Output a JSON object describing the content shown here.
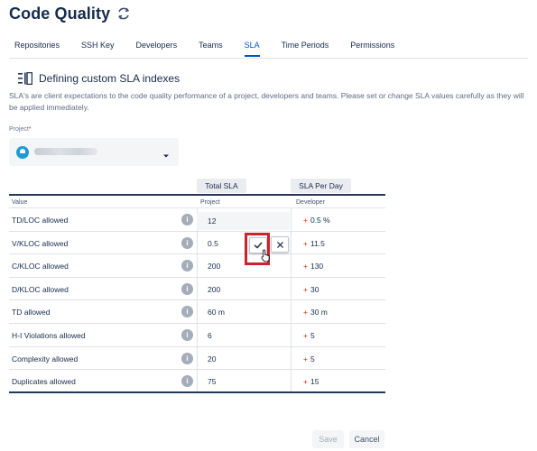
{
  "app": {
    "title": "Code Quality",
    "refresh_icon": "refresh-icon"
  },
  "tabs": [
    {
      "label": "Repositories",
      "active": false
    },
    {
      "label": "SSH Key",
      "active": false
    },
    {
      "label": "Developers",
      "active": false
    },
    {
      "label": "Teams",
      "active": false
    },
    {
      "label": "SLA",
      "active": true
    },
    {
      "label": "Time Periods",
      "active": false
    },
    {
      "label": "Permissions",
      "active": false
    }
  ],
  "section": {
    "title": "Defining custom SLA indexes",
    "icon": "list-settings-icon",
    "description": "SLA's are client expectations to the code quality performance of a project, developers and teams. Please set or change SLA values carefully as they will be applied immediately."
  },
  "project_field": {
    "label": "Project",
    "required_mark": "*",
    "value": ""
  },
  "table": {
    "group_total": "Total SLA",
    "group_per_day": "SLA Per Day",
    "columns": {
      "value": "Value",
      "project": "Project",
      "developer": "Developer"
    },
    "rows": [
      {
        "label": "TD/LOC allowed",
        "project": "12",
        "developer": "0.5 %"
      },
      {
        "label": "V/KLOC allowed",
        "project": "0.5",
        "developer": "11.5"
      },
      {
        "label": "C/KLOC allowed",
        "project": "200",
        "developer": "130"
      },
      {
        "label": "D/KLOC allowed",
        "project": "200",
        "developer": "30"
      },
      {
        "label": "TD allowed",
        "project": "60 m",
        "developer": "30 m"
      },
      {
        "label": "H-I Violations allowed",
        "project": "6",
        "developer": "5"
      },
      {
        "label": "Complexity allowed",
        "project": "20",
        "developer": "5"
      },
      {
        "label": "Duplicates allowed",
        "project": "75",
        "developer": "15"
      }
    ],
    "plus_sign": "+",
    "info_glyph": "i"
  },
  "inline_editor": {
    "confirm_icon": "check-icon",
    "cancel_icon": "close-icon"
  },
  "footer": {
    "save_label": "Save",
    "cancel_label": "Cancel"
  },
  "colors": {
    "accent": "#0052cc",
    "highlight": "#c9252c",
    "plus": "#de350b"
  }
}
